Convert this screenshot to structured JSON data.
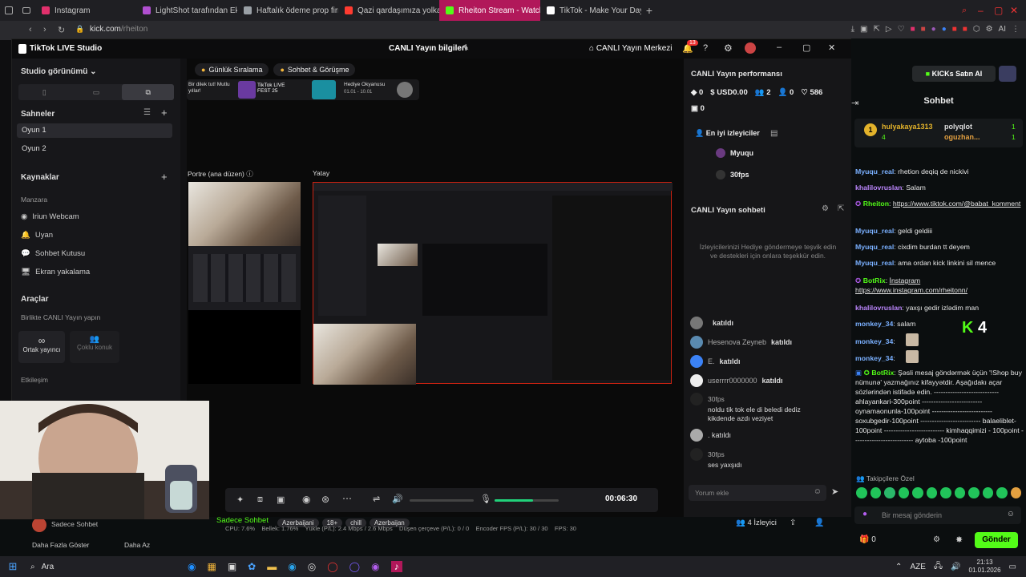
{
  "browser": {
    "tabs": [
      {
        "label": "Instagram",
        "color": "#e1306c"
      },
      {
        "label": "LightShot tarafından Ekran",
        "color": "#b04fd0"
      },
      {
        "label": "Haftalık ödeme prop firma",
        "color": "#9aa0a6"
      },
      {
        "label": "Qazi qardaşımıza yolka al",
        "color": "#ff3b30"
      },
      {
        "label": "Rheiton Stream - Watch L",
        "color": "#53fc18"
      },
      {
        "label": "TikTok - Make Your Day",
        "color": "#ffffff"
      }
    ],
    "url_domain": "kick.com",
    "url_path": "/rheiton"
  },
  "studio": {
    "app_title": "TikTok LIVE Studio",
    "window_title": "CANLI Yayın bilgileri",
    "live_center": "CANLI Yayın Merkezi",
    "notif_count": "13",
    "view_menu": "Studio görünümü",
    "scenes_title": "Sahneler",
    "scenes": [
      "Oyun 1",
      "Oyun 2"
    ],
    "sources_title": "Kaynaklar",
    "sources_section": "Manzara",
    "sources": [
      "Iriun Webcam",
      "Uyan",
      "Sohbet Kutusu",
      "Ekran yakalama"
    ],
    "tools_title": "Araçlar",
    "tools_sub": "Birlikte CANLI Yayın yapın",
    "tool_cohost": "Ortak yayıncı",
    "tool_multi": "Çoklu konuk",
    "interaction": "Etkileşim",
    "top_tabs": [
      "Günlük Sıralama",
      "Sohbet & Görüşme"
    ],
    "banner_text": "Bir dilek tut! Mutlu yıllar!",
    "banner_fest": "TikTok LIVE FEST 25",
    "banner_gift": "Hediye Okyanusu",
    "banner_gift_dates": "01.01 - 10.01",
    "portrait_label": "Portre (ana düzen)",
    "landscape_label": "Yatay",
    "timer": "00:06:30",
    "mic_level": 0.6,
    "stats": "CPU: 7.6%    Bellek: 1.76%    Yükle (P/L): 2.4 Mbps / 2.6 Mbps    Düşen çerçeve (P/L): 0 / 0    Encoder FPS (P/L): 30 / 30    FPS: 30",
    "perf_title": "CANLI Yayın performansı",
    "perf_diamonds": "0",
    "perf_usd": "USD0.00",
    "perf_viewers": "2",
    "perf_new": "0",
    "perf_likes": "586",
    "perf_extra": "0",
    "top_viewers_label": "En iyi izleyiciler",
    "top_viewers": [
      "Myuqu",
      "30fps"
    ],
    "chat_title": "CANLI Yayın sohbeti",
    "chat_empty": "İzleyicilerinizi Hediye göndermeye teşvik edin ve destekleri için onlara teşekkür edin.",
    "chat_rows": [
      {
        "name": "",
        "text": "katıldı"
      },
      {
        "name": "Hesenova Zeyneb",
        "text": "katıldı"
      },
      {
        "name": "E.",
        "text": "katıldı"
      },
      {
        "name": "userrrr0000000",
        "text": "katıldı"
      },
      {
        "name": ".",
        "text": "katıldı"
      }
    ],
    "chat_msg1_name": "30fps",
    "chat_msg1_text": "noldu tik tok ele di beledi dediz kikdende azdı veziyet",
    "chat_row6_text": ". katıldı",
    "chat_msg2_name": "30fps",
    "chat_msg2_text": "ses yaxşıdı",
    "comment_placeholder": "Yorum ekle"
  },
  "kick": {
    "buy_label": "KICKs Satın Al",
    "chat_title": "Sohbet",
    "top_gifter1": "hulyakaya1313",
    "top_gifter1_count": "4",
    "top_gifter2": "polyqlot",
    "top_gifter3": "oguzhan...",
    "top_count2": "1",
    "top_count3": "1",
    "messages": [
      {
        "user": "Myuqu_real",
        "color": "#7ab0ff",
        "text": "rhetion deqiq de nickivi"
      },
      {
        "user": "khalilovruslan",
        "color": "#bb86fc",
        "text": "Salam"
      },
      {
        "user": "Rheiton",
        "color": "#53fc18",
        "text": "https://www.tiktok.com/@babat_komment"
      },
      {
        "user": "Myuqu_real",
        "color": "#7ab0ff",
        "text": "geldi geldiii"
      },
      {
        "user": "Myuqu_real",
        "color": "#7ab0ff",
        "text": "cixdim burdan tt deyem"
      },
      {
        "user": "Myuqu_real",
        "color": "#7ab0ff",
        "text": "ama ordan kick linkini sil mence"
      },
      {
        "user": "BotRix",
        "color": "#53fc18",
        "text": "İnstagram https://www.instagram.com/rheitonn/"
      },
      {
        "user": "khalilovruslan",
        "color": "#bb86fc",
        "text": "yaxşı gedir izlədim man"
      },
      {
        "user": "monkey_34",
        "color": "#7ab0ff",
        "text": "salam"
      },
      {
        "user": "monkey_34",
        "color": "#7ab0ff",
        "text": ""
      },
      {
        "user": "monkey_34",
        "color": "#7ab0ff",
        "text": ""
      }
    ],
    "kick_count": "4",
    "botrix_long": "Şəsli mesaj göndərmək üçün '!Shop buy nümunə' yazmağınız kifayyətdir. Aşağıdakı açar sözlərindən istifadə edin. ---------------------------- ahlayankari-300point -------------------------- oynamaonunla-100point -------------------------- soxubgedir-100point -------------------------- balaeliblet-100point -------------------------- kimhaqqimizi - 100point -------------------------- aytoba -100point",
    "followers_label": "Takipçilere Özel",
    "message_placeholder": "Bir mesaj gönderin",
    "send_label": "Gönder",
    "points": "0"
  },
  "kickpage": {
    "streamer_name": "Sadece Sohbet",
    "category": "Sadece Sohbet",
    "tags": [
      "Azerbaijani",
      "18+",
      "chill",
      "Azerbaijan"
    ],
    "show_more": "Daha Fazla Göster",
    "show_less": "Daha Az",
    "followers_btn": "4 İzleyici"
  },
  "taskbar": {
    "search": "Ara",
    "lang": "AZE",
    "time": "21:13",
    "date": "01.01.2026"
  }
}
